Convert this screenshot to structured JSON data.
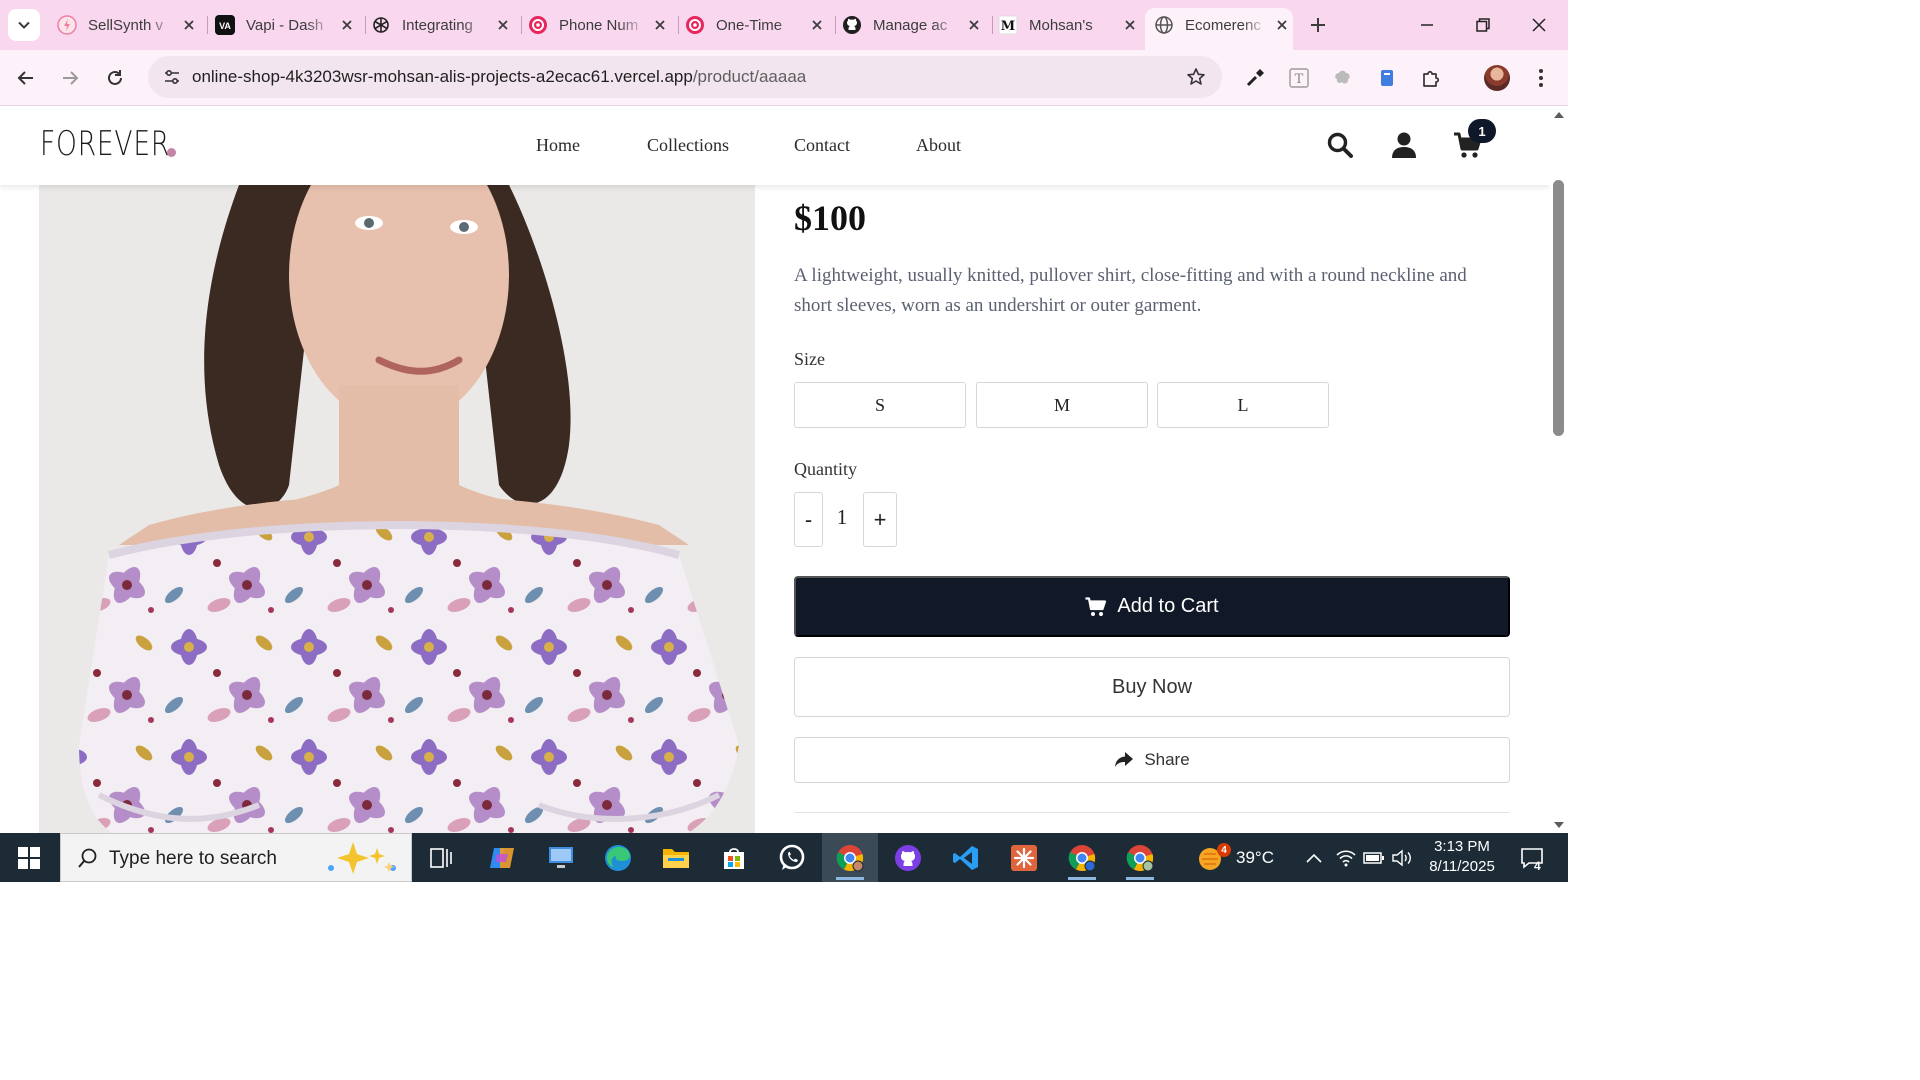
{
  "browser": {
    "tabs": [
      {
        "title": "SellSynth v",
        "icon": "sellsynth-icon",
        "active": false
      },
      {
        "title": "Vapi - Dash",
        "icon": "vapi-icon",
        "active": false
      },
      {
        "title": "Integrating",
        "icon": "openai-icon",
        "active": false
      },
      {
        "title": "Phone Num",
        "icon": "phone-app-icon",
        "active": false
      },
      {
        "title": "One-Time",
        "icon": "phone-app-icon",
        "active": false
      },
      {
        "title": "Manage ac",
        "icon": "github-icon",
        "active": false
      },
      {
        "title": "Mohsan's",
        "icon": "medium-icon",
        "active": false
      },
      {
        "title": "Ecomerenc",
        "icon": "globe-icon",
        "active": true
      }
    ],
    "url": {
      "host": "online-shop-4k3203wsr-mohsan-alis-projects-a2ecac61.vercel.app",
      "path": "/product/aaaaa"
    },
    "theme_color": "#f9d7ef"
  },
  "site": {
    "logo": "FOREVER",
    "logo_dot_color": "#c586a5",
    "nav": [
      "Home",
      "Collections",
      "Contact",
      "About"
    ],
    "cart_count": "1"
  },
  "product": {
    "price": "$100",
    "description": "A lightweight, usually knitted, pullover shirt, close-fitting and with a round neckline and short sleeves, worn as an undershirt or outer garment.",
    "size_label": "Size",
    "sizes": [
      "S",
      "M",
      "L"
    ],
    "quantity_label": "Quantity",
    "quantity": "1",
    "decrement": "-",
    "increment": "+",
    "add_to_cart": "Add to Cart",
    "buy_now": "Buy Now",
    "share": "Share",
    "accent": "#111827"
  },
  "taskbar": {
    "search_placeholder": "Type here to search",
    "weather": "39°C",
    "weather_badge": "4",
    "time": "3:13 PM",
    "date": "8/11/2025",
    "notifications": "4"
  }
}
